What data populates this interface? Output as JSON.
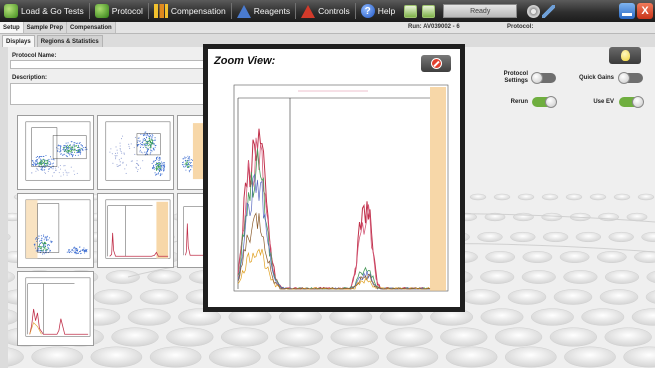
{
  "toolbar": {
    "load_go": "Load & Go Tests",
    "protocol": "Protocol",
    "compensation": "Compensation",
    "reagents": "Reagents",
    "controls": "Controls",
    "help": "Help",
    "help_glyph": "?",
    "status": "Ready",
    "close_glyph": "X",
    "icons": [
      "load-go-icon",
      "protocol-icon",
      "compensation-icon",
      "reagents-icon",
      "controls-icon",
      "help-icon",
      "worklist-icon",
      "export-icon",
      "settings-gear-icon",
      "tools-icon",
      "minimize-icon",
      "close-icon"
    ]
  },
  "tabs": {
    "setup": "Setup",
    "sample_prep": "Sample Prep",
    "compensation": "Compensation",
    "run": "Run: AV039002 - 6",
    "protocol": "Protocol:"
  },
  "subtabs": {
    "displays": "Displays",
    "regions": "Regions & Statistics"
  },
  "form": {
    "protocol_name": "Protocol Name:",
    "description": "Description:"
  },
  "options": {
    "protocol_settings": "Protocol Settings",
    "quick_gains": "Quick Gains",
    "rerun": "Rerun",
    "use_ev": "Use EV",
    "state": {
      "protocol_settings": false,
      "quick_gains": false,
      "rerun": true,
      "use_ev": true
    }
  },
  "zoom": {
    "title": "Zoom View:"
  },
  "colors": {
    "accent_green": "#6fae3f",
    "gate_orange": "#f7d7a8",
    "histogram_red": "#c0304a"
  }
}
